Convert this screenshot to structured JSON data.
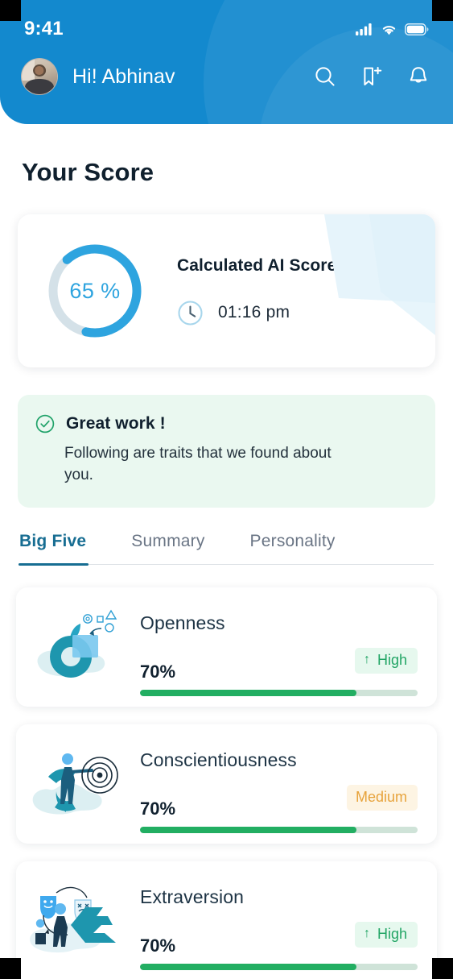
{
  "theme": {
    "header_blue": "#1389CE",
    "accent_blue": "#2EA4DF",
    "tab_active": "#176D92",
    "green": "#22AE62",
    "badge_high_text": "#22A565",
    "badge_high_bg": "#E6F8EE",
    "badge_medium_text": "#E7A33C",
    "badge_medium_bg": "#FDF4E3",
    "alert_bg": "#EAF8F0",
    "text_dark": "#10202E"
  },
  "status_bar": {
    "time": "9:41",
    "signal_icon": "cellular-signal-icon",
    "wifi_icon": "wifi-icon",
    "battery_icon": "battery-icon"
  },
  "header": {
    "greeting": "Hi! Abhinav",
    "avatar_icon": "avatar",
    "actions": [
      {
        "name": "search-icon",
        "label": "Search"
      },
      {
        "name": "bookmark-add-icon",
        "label": "Bookmark"
      },
      {
        "name": "bell-icon",
        "label": "Notifications"
      }
    ]
  },
  "page": {
    "title": "Your Score"
  },
  "score_card": {
    "percent_label": "65 %",
    "percent_value": 65,
    "title": "Calculated AI Score",
    "time": "01:16 pm",
    "clock_icon": "clock-icon"
  },
  "alert": {
    "icon": "check-circle-icon",
    "title": "Great work !",
    "message": "Following are traits  that we found about you."
  },
  "tabs": [
    {
      "label": "Big Five",
      "active": true
    },
    {
      "label": "Summary",
      "active": false
    },
    {
      "label": "Personality",
      "active": false
    }
  ],
  "traits": [
    {
      "name": "Openness",
      "value_label": "70%",
      "value": 70,
      "bar_percent": 78,
      "badge": {
        "label": "High",
        "arrow": "↑",
        "style": "high"
      },
      "illustration": "openness-illustration"
    },
    {
      "name": "Conscientiousness",
      "value_label": "70%",
      "value": 70,
      "bar_percent": 78,
      "badge": {
        "label": "Medium",
        "arrow": "",
        "style": "medium"
      },
      "illustration": "conscientiousness-illustration"
    },
    {
      "name": "Extraversion",
      "value_label": "70%",
      "value": 70,
      "bar_percent": 78,
      "badge": {
        "label": "High",
        "arrow": "↑",
        "style": "high"
      },
      "illustration": "extraversion-illustration"
    }
  ]
}
